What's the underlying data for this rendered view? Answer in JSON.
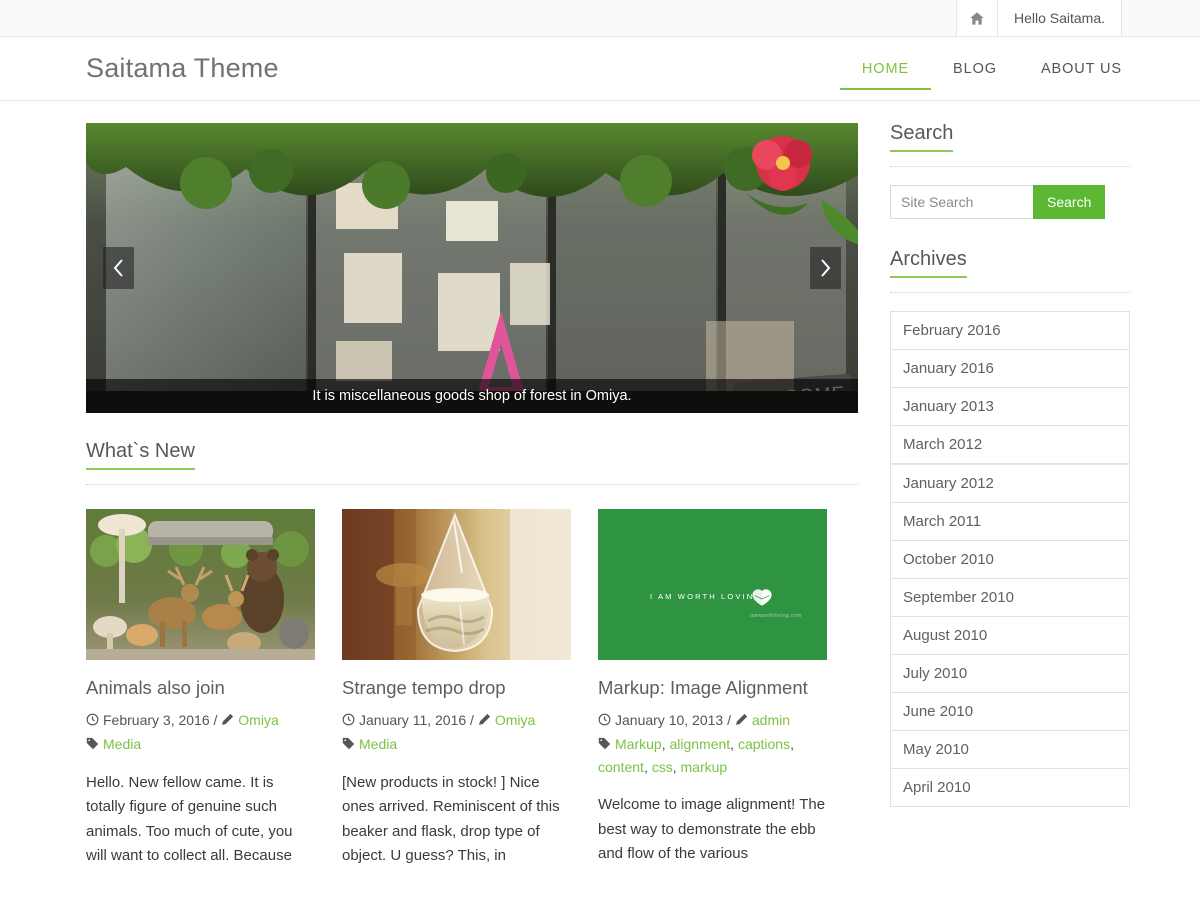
{
  "topbar": {
    "home_icon": "home-icon",
    "greeting": "Hello Saitama."
  },
  "header": {
    "site_title": "Saitama Theme",
    "nav": [
      {
        "label": "HOME",
        "active": true
      },
      {
        "label": "BLOG",
        "active": false
      },
      {
        "label": "ABOUT US",
        "active": false
      }
    ]
  },
  "slider": {
    "caption": "It is miscellaneous goods shop of forest in Omiya.",
    "prev_icon": "chevron-left-icon",
    "next_icon": "chevron-right-icon"
  },
  "whats_new": {
    "title": "What`s New",
    "posts": [
      {
        "title": "Animals also join",
        "date": "February 3, 2016",
        "author": "Omiya",
        "separator": "/",
        "tags": [
          "Media"
        ],
        "excerpt": "Hello. New fellow came. It is totally figure of genuine such animals. Too much of cute, you will want to collect all. Because",
        "thumb_alt": "animal-figurines-photo"
      },
      {
        "title": "Strange tempo drop",
        "date": "January 11, 2016",
        "author": "Omiya",
        "separator": "/",
        "tags": [
          "Media"
        ],
        "excerpt": "[New products in stock! ] Nice ones arrived. Reminiscent of this beaker and flask, drop type of object. U guess? This, in",
        "thumb_alt": "glass-teardrop-flask-photo"
      },
      {
        "title": "Markup: Image Alignment",
        "date": "January 10, 2013",
        "author": "admin",
        "separator": "/",
        "tags": [
          "Markup",
          "alignment",
          "captions",
          "content",
          "css",
          "markup"
        ],
        "excerpt": "Welcome to image alignment! The best way to demonstrate the ebb and flow of the various",
        "thumb_alt": "green-i-am-worth-loving-graphic",
        "thumb_text": "I AM WORTH LOVING",
        "thumb_subtext": "iamworthloving.com"
      }
    ]
  },
  "sidebar": {
    "search": {
      "title": "Search",
      "placeholder": "Site Search",
      "value": "",
      "button_label": "Search"
    },
    "archives": {
      "title": "Archives",
      "items": [
        "February 2016",
        "January 2016",
        "January 2013",
        "March 2012",
        "January 2012",
        "March 2011",
        "October 2010",
        "September 2010",
        "August 2010",
        "July 2010",
        "June 2010",
        "May 2010",
        "April 2010"
      ]
    }
  },
  "colors": {
    "accent_green": "#7cc243",
    "button_green": "#5cb733",
    "underline_green": "#8dc95a",
    "title_gray": "#6f7376",
    "thumb_green": "#2f9442"
  }
}
